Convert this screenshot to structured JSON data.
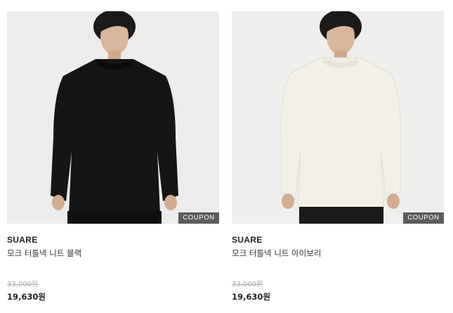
{
  "products": [
    {
      "brand": "SUARE",
      "name": "모크 터틀넥 니트 블랙",
      "original_price": "33,000원",
      "sale_price": "19,630원",
      "badge": "COUPON",
      "sweater_color": "#151515",
      "background_color": "#ececea"
    },
    {
      "brand": "SUARE",
      "name": "모크 터틀넥 니트 아이보리",
      "original_price": "33,000원",
      "sale_price": "19,630원",
      "badge": "COUPON",
      "sweater_color": "#f1efe6",
      "background_color": "#eeeeec"
    }
  ]
}
